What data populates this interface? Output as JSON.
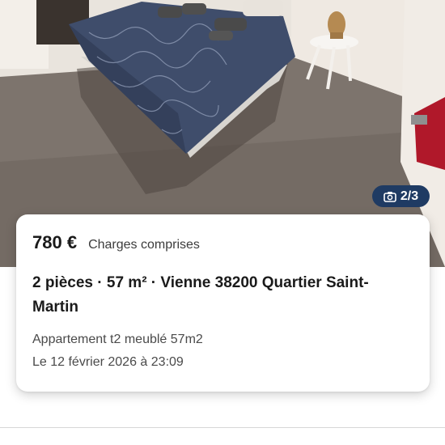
{
  "listing": {
    "photo_counter": "2/3",
    "price": "780 €",
    "charges": "Charges comprises",
    "title": "2 pièces · 57 m² · Vienne 38200 Quartier Saint-Martin",
    "description": "Appartement t2 meublé 57m2",
    "date": "Le 12 février 2026 à 23:09"
  },
  "icons": {
    "camera": "camera-icon"
  },
  "colors": {
    "badge_bg": "#1f3b63",
    "card_bg": "#ffffff",
    "text_primary": "#1a1a1a",
    "text_secondary": "#4a4a4a"
  }
}
